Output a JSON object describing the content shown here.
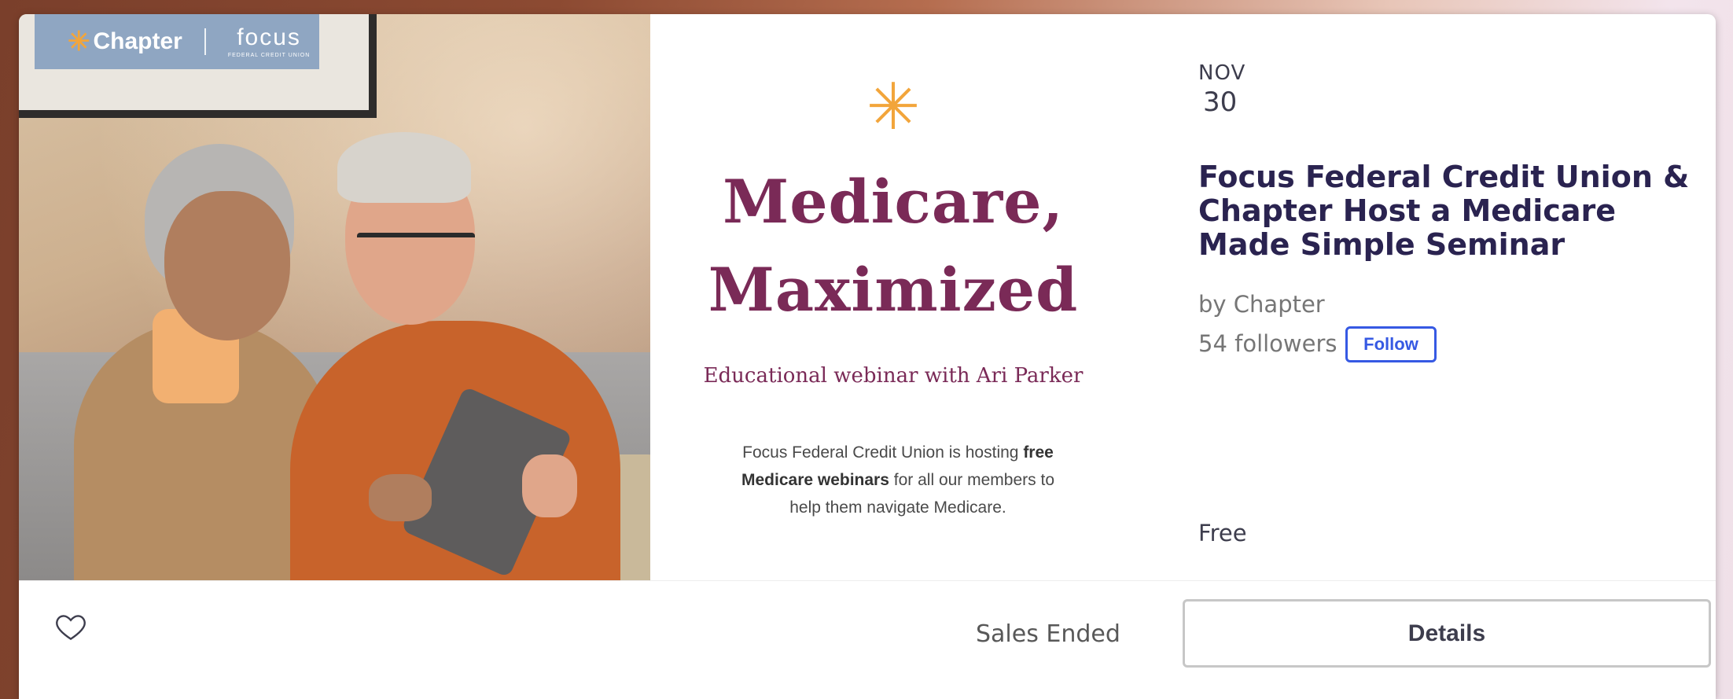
{
  "banner": {
    "logo_chapter": "Chapter",
    "logo_focus": "focus",
    "logo_focus_sub": "FEDERAL CREDIT UNION",
    "promo_title_line1": "Medicare,",
    "promo_title_line2": "Maximized",
    "promo_subtitle": "Educational webinar with Ari Parker",
    "promo_body_pre": "Focus Federal Credit Union is hosting ",
    "promo_body_bold": "free Medicare webinars",
    "promo_body_post": " for all our members to help them navigate Medicare.",
    "accent_color": "#f2a53b",
    "title_color": "#7a2a57"
  },
  "event": {
    "month": "NOV",
    "day": "30",
    "title": "Focus Federal Credit Union & Chapter Host a Medicare Made Simple Seminar",
    "organizer": "by Chapter",
    "followers": "54 followers",
    "follow_label": "Follow",
    "price": "Free"
  },
  "footer": {
    "sales_status": "Sales Ended",
    "details_label": "Details",
    "like_icon": "heart-icon"
  }
}
